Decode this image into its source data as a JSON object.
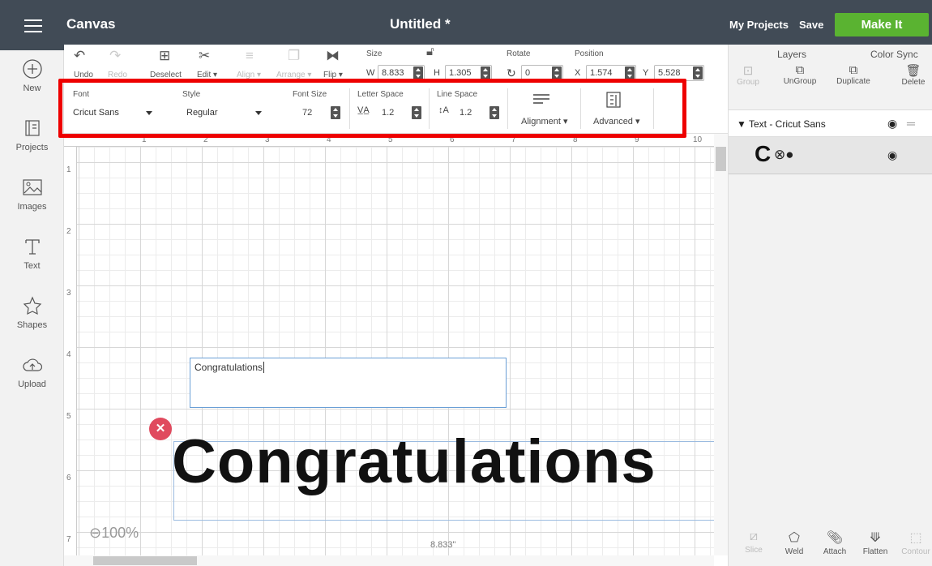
{
  "header": {
    "app_label": "Canvas",
    "title": "Untitled *",
    "my_projects": "My Projects",
    "save": "Save",
    "make_it": "Make It"
  },
  "leftnav": {
    "items": [
      {
        "label": "New",
        "icon": "plus-circle-icon"
      },
      {
        "label": "Projects",
        "icon": "projects-icon"
      },
      {
        "label": "Images",
        "icon": "image-icon"
      },
      {
        "label": "Text",
        "icon": "text-t-icon"
      },
      {
        "label": "Shapes",
        "icon": "shapes-icon"
      },
      {
        "label": "Upload",
        "icon": "cloud-upload-icon"
      }
    ]
  },
  "toolbar": {
    "undo": "Undo",
    "redo": "Redo",
    "deselect": "Deselect",
    "edit": "Edit",
    "align": "Align",
    "arrange": "Arrange",
    "flip": "Flip",
    "size_label": "Size",
    "w_label": "W",
    "w_value": "8.833",
    "h_label": "H",
    "h_value": "1.305",
    "rotate_label": "Rotate",
    "rotate_value": "0",
    "position_label": "Position",
    "x_label": "X",
    "x_value": "1.574",
    "y_label": "Y",
    "y_value": "5.528"
  },
  "text_toolbar": {
    "font_label": "Font",
    "font_value": "Cricut Sans",
    "style_label": "Style",
    "style_value": "Regular",
    "font_size_label": "Font Size",
    "font_size_value": "72",
    "letter_space_label": "Letter Space",
    "letter_space_value": "1.2",
    "line_space_label": "Line Space",
    "line_space_value": "1.2",
    "alignment": "Alignment",
    "advanced": "Advanced"
  },
  "canvas": {
    "ruler_top": [
      "1",
      "2",
      "3",
      "4",
      "5",
      "6",
      "7",
      "8",
      "9",
      "10"
    ],
    "ruler_left": [
      "1",
      "2",
      "3",
      "4",
      "5",
      "6",
      "7"
    ],
    "text_input_value": "Congratulations",
    "rendered_text": "Congratulations",
    "zoom": "100%",
    "width_readout": "8.833\""
  },
  "right_panel": {
    "tabs": [
      "Layers",
      "Color Sync"
    ],
    "actions": [
      "Group",
      "UnGroup",
      "Duplicate",
      "Delete"
    ],
    "layer_title": "Text - Cricut Sans",
    "layer_preview": "C",
    "bottom_actions": [
      "Slice",
      "Weld",
      "Attach",
      "Flatten",
      "Contour"
    ]
  },
  "colors": {
    "topbar": "#414b56",
    "make_it": "#5ab331",
    "highlight": "#ee0000",
    "delete_badge": "#e04a5e"
  }
}
